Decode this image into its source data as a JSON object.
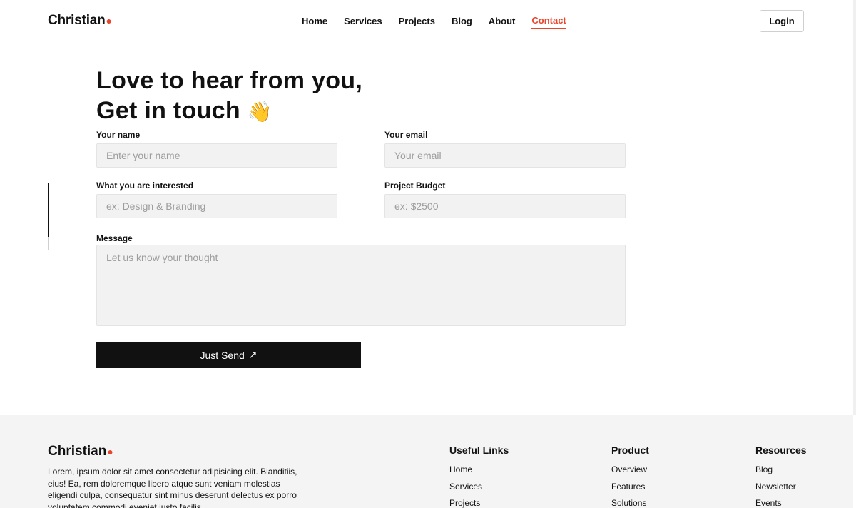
{
  "brand": {
    "name": "Christian"
  },
  "nav": {
    "items": [
      {
        "label": "Home"
      },
      {
        "label": "Services"
      },
      {
        "label": "Projects"
      },
      {
        "label": "Blog"
      },
      {
        "label": "About"
      },
      {
        "label": "Contact"
      }
    ],
    "active": "Contact",
    "login_label": "Login"
  },
  "hero": {
    "line1": "Love to hear from you,",
    "line2": "Get in touch",
    "emoji": "👋"
  },
  "form": {
    "name": {
      "label": "Your name",
      "placeholder": "Enter your name"
    },
    "email": {
      "label": "Your email",
      "placeholder": "Your email"
    },
    "interest": {
      "label": "What you are interested",
      "placeholder": "ex: Design & Branding"
    },
    "budget": {
      "label": "Project Budget",
      "placeholder": "ex: $2500"
    },
    "message": {
      "label": "Message",
      "placeholder": "Let us know your thought"
    },
    "submit_label": "Just Send",
    "submit_icon": "↗"
  },
  "footer": {
    "brand": "Christian",
    "description": "Lorem, ipsum dolor sit amet consectetur adipisicing elit. Blanditiis, eius! Ea, rem doloremque libero atque sunt veniam molestias eligendi culpa, consequatur sint minus deserunt delectus ex porro voluptatem commodi eveniet iusto facilis.",
    "columns": [
      {
        "title": "Useful Links",
        "links": [
          "Home",
          "Services",
          "Projects"
        ]
      },
      {
        "title": "Product",
        "links": [
          "Overview",
          "Features",
          "Solutions"
        ]
      },
      {
        "title": "Resources",
        "links": [
          "Blog",
          "Newsletter",
          "Events"
        ]
      }
    ]
  },
  "colors": {
    "accent": "#e8452c",
    "button_dark": "#111111",
    "field_bg": "#f2f2f2",
    "footer_bg": "#f4f4f4"
  }
}
